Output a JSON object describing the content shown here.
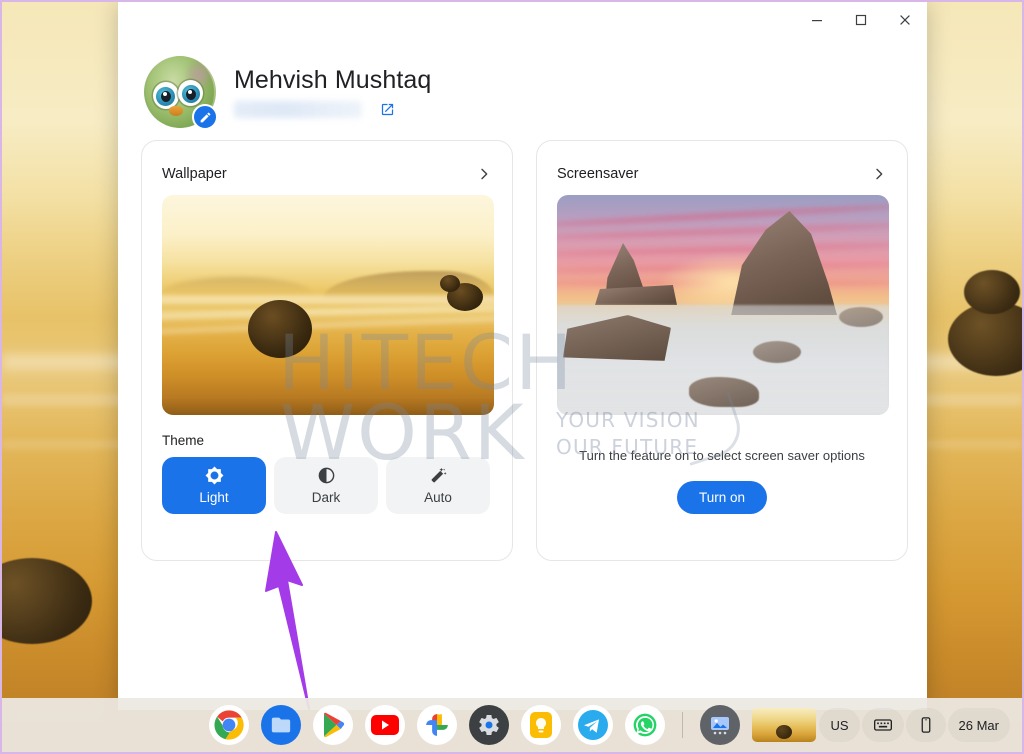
{
  "window": {
    "controls": [
      {
        "name": "minimize",
        "glyph": "minimize-icon",
        "label": "Minimize"
      },
      {
        "name": "maximize",
        "glyph": "maximize-icon",
        "label": "Maximize"
      },
      {
        "name": "close",
        "glyph": "close-icon",
        "label": "Close"
      }
    ]
  },
  "profile": {
    "name": "Mehvish Mushtaq",
    "email": "",
    "email_hidden": true,
    "avatar_icon": "user-avatar",
    "edit_icon": "pencil-icon",
    "external_link_icon": "open-in-new-icon"
  },
  "wallpaper_card": {
    "title": "Wallpaper",
    "chevron_icon": "chevron-right-icon",
    "preview_icon": "wallpaper-preview-beach-sunset",
    "theme": {
      "label": "Theme",
      "selected": "Light",
      "options": [
        {
          "label": "Light",
          "icon": "brightness-sun-icon",
          "selected": true
        },
        {
          "label": "Dark",
          "icon": "contrast-half-circle-icon",
          "selected": false
        },
        {
          "label": "Auto",
          "icon": "magic-wand-sparkle-icon",
          "selected": false
        }
      ]
    }
  },
  "screensaver_card": {
    "title": "Screensaver",
    "chevron_icon": "chevron-right-icon",
    "preview_icon": "screensaver-preview-cathedral-rocks",
    "message": "Turn the feature on to select screen saver options",
    "button_label": "Turn on"
  },
  "watermark": {
    "line1": "HITECH",
    "line2": "WORK",
    "tagline1": "YOUR VISION",
    "tagline2": "OUR FUTURE"
  },
  "shelf": {
    "apps": [
      {
        "name": "chrome",
        "label": "Chrome",
        "running": false
      },
      {
        "name": "files",
        "label": "Files",
        "running": false
      },
      {
        "name": "play-store",
        "label": "Play Store",
        "running": false
      },
      {
        "name": "youtube",
        "label": "YouTube",
        "running": false
      },
      {
        "name": "photos",
        "label": "Google Photos",
        "running": false
      },
      {
        "name": "settings",
        "label": "Settings",
        "running": true
      },
      {
        "name": "keep",
        "label": "Keep",
        "running": false
      },
      {
        "name": "telegram",
        "label": "Telegram",
        "running": false
      },
      {
        "name": "whatsapp",
        "label": "WhatsApp",
        "running": false
      },
      {
        "name": "gallery",
        "label": "Gallery",
        "running": true
      }
    ],
    "wallpaper_thumb": "wallpaper-thumbnail",
    "status": {
      "keyboard_layout": "US",
      "keyboard_icon": "keyboard-icon",
      "device_icon": "phone-hub-icon",
      "date": "26 Mar"
    }
  },
  "annotation": {
    "arrow_icon": "arrow-pointer-up-left",
    "color": "#a33ce8"
  },
  "colors": {
    "accent": "#1a73e8",
    "surface": "#ffffff",
    "chip": "#f1f3f4",
    "text": "#202124",
    "shelf": "#ece8e1",
    "annotation": "#a33ce8"
  }
}
